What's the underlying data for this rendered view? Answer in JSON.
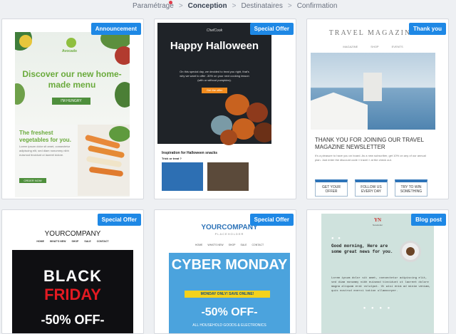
{
  "stepper": {
    "steps": [
      "Paramétrage",
      "Conception",
      "Destinataires",
      "Confirmation"
    ],
    "active_index": 1,
    "separator": ">"
  },
  "templates": [
    {
      "badge": "Announcement",
      "logo": "Avocado",
      "title": "Discover our new home-made menu",
      "button": "I'M HUNGRY",
      "subtitle": "The freshest vegetables for you.",
      "body": "Lorem ipsum dolor sit amet, consectetur adipiscing elit, sed diam nonummy nibh euismod tincidunt ut laoreet dolore.",
      "cta": "ORDER NOW"
    },
    {
      "badge": "Special Offer",
      "logo": "ChefCook",
      "title": "Happy Halloween",
      "body": "On this special day, we decided to treat you right, that's why we want to offer -30% on your next cooking lesson (with or without pumpkins).",
      "button": "Get the offer",
      "subtitle": "Inspiration for Halloween snacks",
      "subtitle2": "Trick or treat ?"
    },
    {
      "badge": "Thank you",
      "masthead": "TRAVEL MAGAZINE",
      "nav": [
        "MAGAZINE",
        "SHOP",
        "EVENTS"
      ],
      "heading": "THANK YOU FOR JOINING OUR TRAVEL MAGAZINE NEWSLETTER",
      "body": "It's a pleasure to have you on board. As a new subscriber, get 10% on any of our annual plan. Just enter the discount code « travel » at the check out.",
      "boxes": [
        "GET YOUR OFFER",
        "FOLLOW US EVERY DAY",
        "TRY TO WIN SOMETHING"
      ]
    },
    {
      "badge": "Special Offer",
      "logo": "YOURCOMPANY",
      "nav": [
        "HOME",
        "WHAT'S NEW",
        "SHOP",
        "SALE",
        "CONTACT"
      ],
      "line1": "BLACK",
      "line2": "FRIDAY",
      "offer": "-50% OFF-"
    },
    {
      "badge": "Special Offer",
      "logo": "YOURCOMPANY",
      "placeholder": "PLACEHOLDER",
      "nav": [
        "HOME",
        "WHAT'S NEW",
        "SHOP",
        "SALE",
        "CONTACT"
      ],
      "title": "CYBER MONDAY",
      "banner": "MONDAY ONLY! SAVE ONLINE!",
      "offer": "-50% OFF-",
      "footer": "ALL HOUSEHOLD GOODS & ELECTRONICS"
    },
    {
      "badge": "Blog post",
      "logo": "YN",
      "logo_sub": "Newsletter",
      "dots": "● ●",
      "greeting": "Good morning, Here are some great news for you.",
      "body": "Lorem ipsum dolor sit amet, consectetur adipiscing elit, sed diam nonummy nibh euismod tincidunt ut laoreet dolore magna aliquam erat volutpat. Ut wisi enim ad minim veniam, quis nostrud exerci tation ullamcorper.",
      "divider": "● ● ● ●"
    }
  ],
  "colors": {
    "badge": "#1e88e5",
    "active_dot": "#e23d4b"
  }
}
